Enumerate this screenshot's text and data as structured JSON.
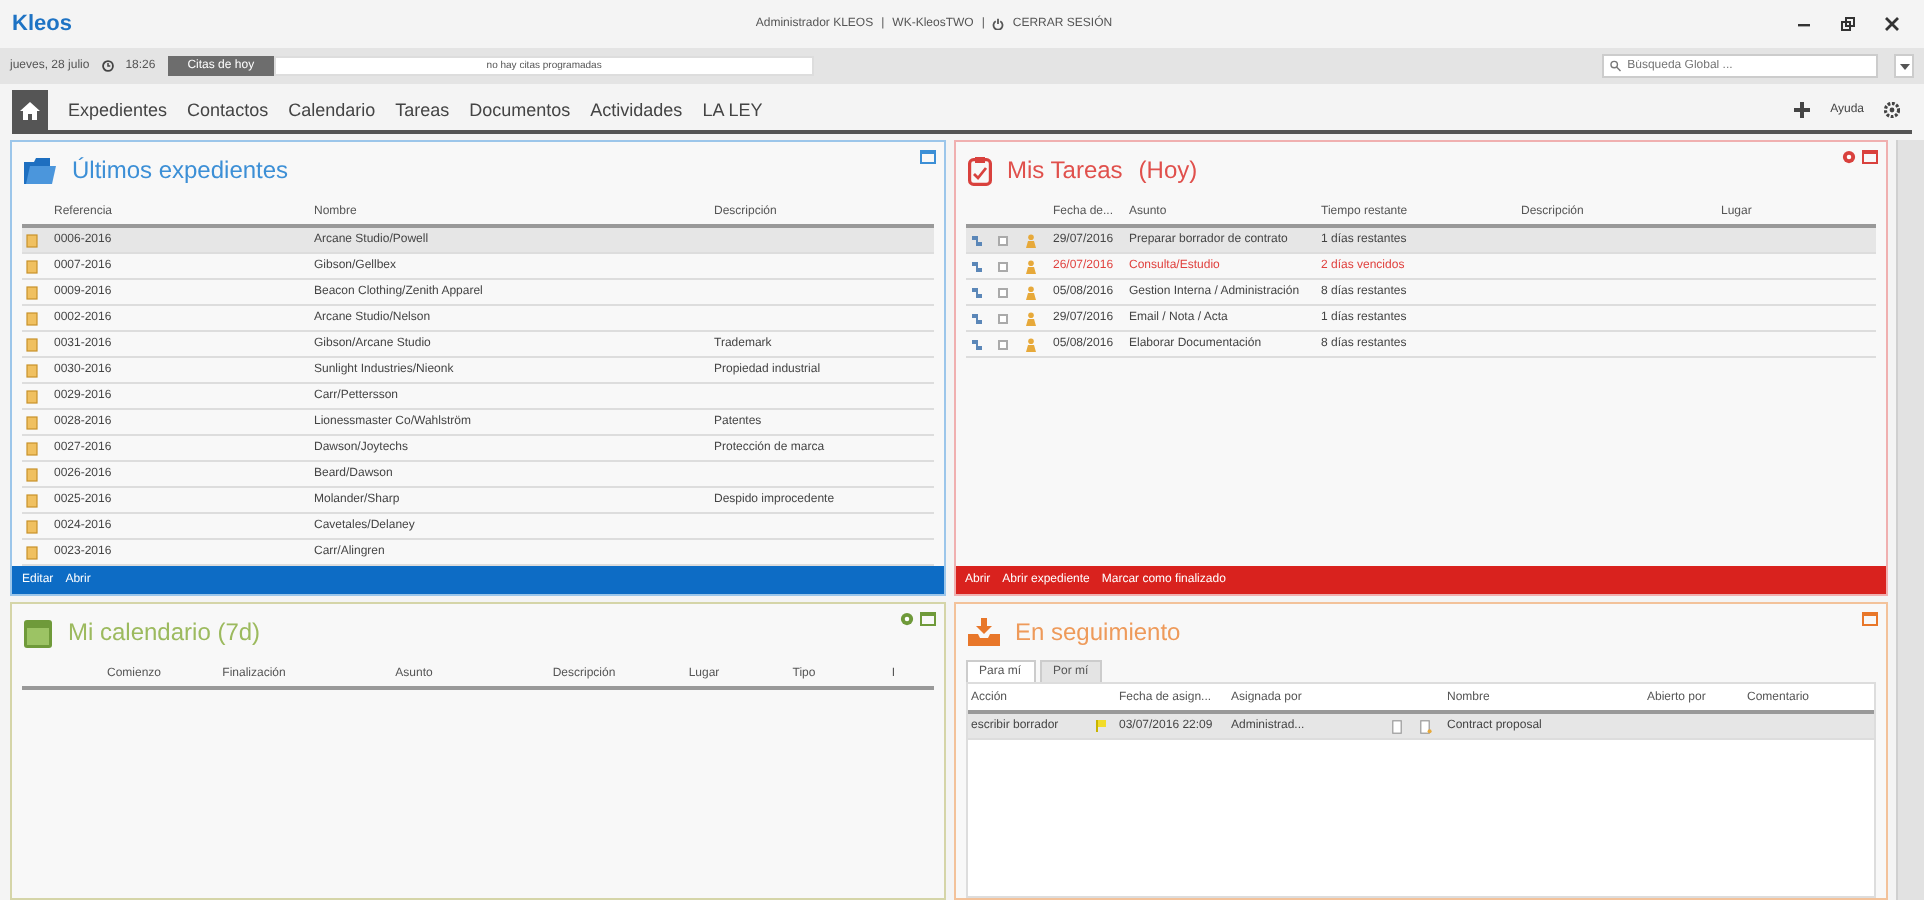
{
  "app_title": "Kleos",
  "session": {
    "user": "Administrador KLEOS",
    "separator_1": "|",
    "workstation": "WK-KleosTWO",
    "separator_2": "|",
    "logout": "CERRAR SESIÓN"
  },
  "info_bar": {
    "date": "jueves, 28 julio",
    "time": "18:26",
    "today_button": "Citas de hoy",
    "message": "no hay citas programadas",
    "search": {
      "placeholder": "Búsqueda Global ..."
    }
  },
  "nav": {
    "items": [
      {
        "label": "Expedientes"
      },
      {
        "label": "Contactos"
      },
      {
        "label": "Calendario"
      },
      {
        "label": "Tareas"
      },
      {
        "label": "Documentos"
      },
      {
        "label": "Actividades"
      },
      {
        "label": "LA LEY"
      }
    ],
    "help": "Ayuda"
  },
  "files_panel": {
    "title": "Últimos expedientes",
    "columns": [
      "Referencia",
      "Nombre",
      "Descripción"
    ],
    "rows": [
      {
        "cells": [
          "0006-2016",
          "Arcane Studio/Powell",
          ""
        ],
        "selected": true
      },
      {
        "cells": [
          "0007-2016",
          "Gibson/Gellbex",
          ""
        ],
        "selected": false
      },
      {
        "cells": [
          "0009-2016",
          "Beacon Clothing/Zenith Apparel",
          ""
        ],
        "selected": false
      },
      {
        "cells": [
          "0002-2016",
          "Arcane Studio/Nelson",
          ""
        ],
        "selected": false
      },
      {
        "cells": [
          "0031-2016",
          "Gibson/Arcane Studio",
          "Trademark"
        ],
        "selected": false
      },
      {
        "cells": [
          "0030-2016",
          "Sunlight Industries/Nieonk",
          "Propiedad industrial"
        ],
        "selected": false
      },
      {
        "cells": [
          "0029-2016",
          "Carr/Pettersson",
          ""
        ],
        "selected": false
      },
      {
        "cells": [
          "0028-2016",
          "Lionessmaster Co/Wahlström",
          "Patentes"
        ],
        "selected": false
      },
      {
        "cells": [
          "0027-2016",
          "Dawson/Joytechs",
          "Protección de marca"
        ],
        "selected": false
      },
      {
        "cells": [
          "0026-2016",
          "Beard/Dawson",
          ""
        ],
        "selected": false
      },
      {
        "cells": [
          "0025-2016",
          "Molander/Sharp",
          "Despido improcedente"
        ],
        "selected": false
      },
      {
        "cells": [
          "0024-2016",
          "Cavetales/Delaney",
          ""
        ],
        "selected": false
      },
      {
        "cells": [
          "0023-2016",
          "Carr/Alingren",
          ""
        ],
        "selected": false
      }
    ],
    "actions": [
      "Editar",
      "Abrir"
    ]
  },
  "tasks_panel": {
    "title": "Mis Tareas",
    "subtitle": "(Hoy)",
    "columns": [
      "Fecha de...",
      "Asunto",
      "Tiempo restante",
      "Descripción",
      "Lugar"
    ],
    "rows": [
      {
        "date": "29/07/2016",
        "subject": "Preparar borrador de contrato",
        "remaining": "1 días restantes",
        "checked": false,
        "overdue": false,
        "selected": true
      },
      {
        "date": "26/07/2016",
        "subject": "Consulta/Estudio",
        "remaining": "2 días vencidos",
        "checked": false,
        "overdue": true,
        "selected": false
      },
      {
        "date": "05/08/2016",
        "subject": "Gestion Interna / Administración",
        "remaining": "8 días restantes",
        "checked": false,
        "overdue": false,
        "selected": false
      },
      {
        "date": "29/07/2016",
        "subject": "Email / Nota / Acta",
        "remaining": "1 días restantes",
        "checked": false,
        "overdue": false,
        "selected": false
      },
      {
        "date": "05/08/2016",
        "subject": "Elaborar Documentación",
        "remaining": "8 días restantes",
        "checked": false,
        "overdue": false,
        "selected": false
      }
    ],
    "actions": [
      "Abrir",
      "Abrir expediente",
      "Marcar como finalizado"
    ]
  },
  "calendar_panel": {
    "title": "Mi calendario (7d)",
    "columns": [
      "Comienzo",
      "Finalización",
      "Asunto",
      "Descripción",
      "Lugar",
      "Tipo",
      "I"
    ]
  },
  "follow_panel": {
    "title": "En seguimiento",
    "tabs": [
      {
        "label": "Para mí",
        "selected": true
      },
      {
        "label": "Por mí",
        "selected": false
      }
    ],
    "columns": [
      "Acción",
      "Fecha de asign...",
      "Asignada por",
      "Nombre",
      "Abierto por",
      "Comentario"
    ],
    "rows": [
      {
        "action": "escribir borrador",
        "date": "03/07/2016 22:09",
        "assigned_by": "Administrad...",
        "name": "Contract proposal",
        "opened_by": "",
        "comment": "",
        "selected": true
      }
    ]
  }
}
